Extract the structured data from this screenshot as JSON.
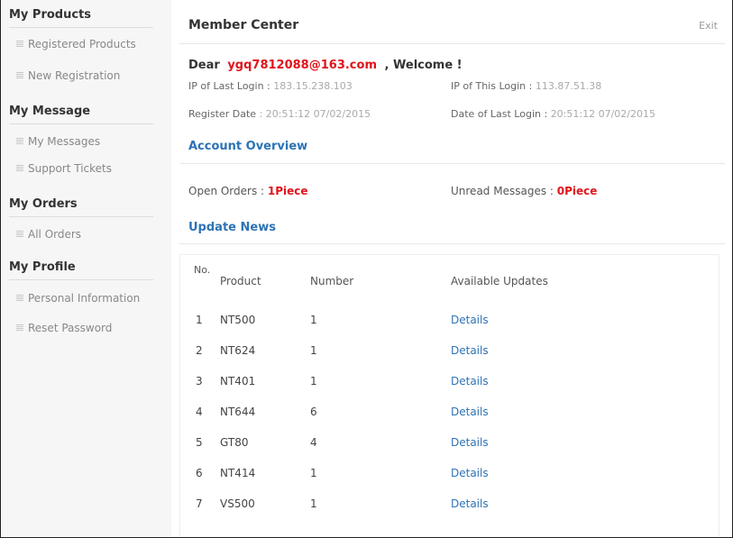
{
  "sidebar": {
    "sections": [
      {
        "title": "My Products",
        "items": [
          "Registered Products",
          "New Registration"
        ]
      },
      {
        "title": "My Message",
        "items": [
          "My Messages",
          "Support Tickets"
        ]
      },
      {
        "title": "My Orders",
        "items": [
          "All Orders"
        ]
      },
      {
        "title": "My Profile",
        "items": [
          "Personal Information",
          "Reset Password"
        ]
      }
    ]
  },
  "header": {
    "title": "Member Center",
    "exit": "Exit"
  },
  "welcome": {
    "dear": "Dear",
    "email": "ygq7812088@163.com",
    "welcome": ", Welcome !",
    "ip_last_label": "IP of Last Login :",
    "ip_last": "183.15.238.103",
    "ip_this_label": "IP of This Login :",
    "ip_this": "113.87.51.38",
    "reg_label": "Register Date",
    "reg_date": ": 20:51:12 07/02/2015",
    "last_login_label": "Date of Last Login :",
    "last_login": "20:51:12 07/02/2015"
  },
  "overview": {
    "title": "Account Overview",
    "open_orders_label": "Open Orders :",
    "open_orders_value": "1Piece",
    "unread_label": "Unread Messages :",
    "unread_value": "0Piece"
  },
  "updates": {
    "title": "Update News",
    "columns": {
      "no": "No.",
      "product": "Product",
      "number": "Number",
      "available": "Available Updates"
    },
    "rows": [
      {
        "no": "1",
        "product": "NT500",
        "number": "1",
        "link": "Details"
      },
      {
        "no": "2",
        "product": "NT624",
        "number": "1",
        "link": "Details"
      },
      {
        "no": "3",
        "product": "NT401",
        "number": "1",
        "link": "Details"
      },
      {
        "no": "4",
        "product": "NT644",
        "number": "6",
        "link": "Details"
      },
      {
        "no": "5",
        "product": "GT80",
        "number": "4",
        "link": "Details"
      },
      {
        "no": "6",
        "product": "NT414",
        "number": "1",
        "link": "Details"
      },
      {
        "no": "7",
        "product": "VS500",
        "number": "1",
        "link": "Details"
      }
    ]
  }
}
